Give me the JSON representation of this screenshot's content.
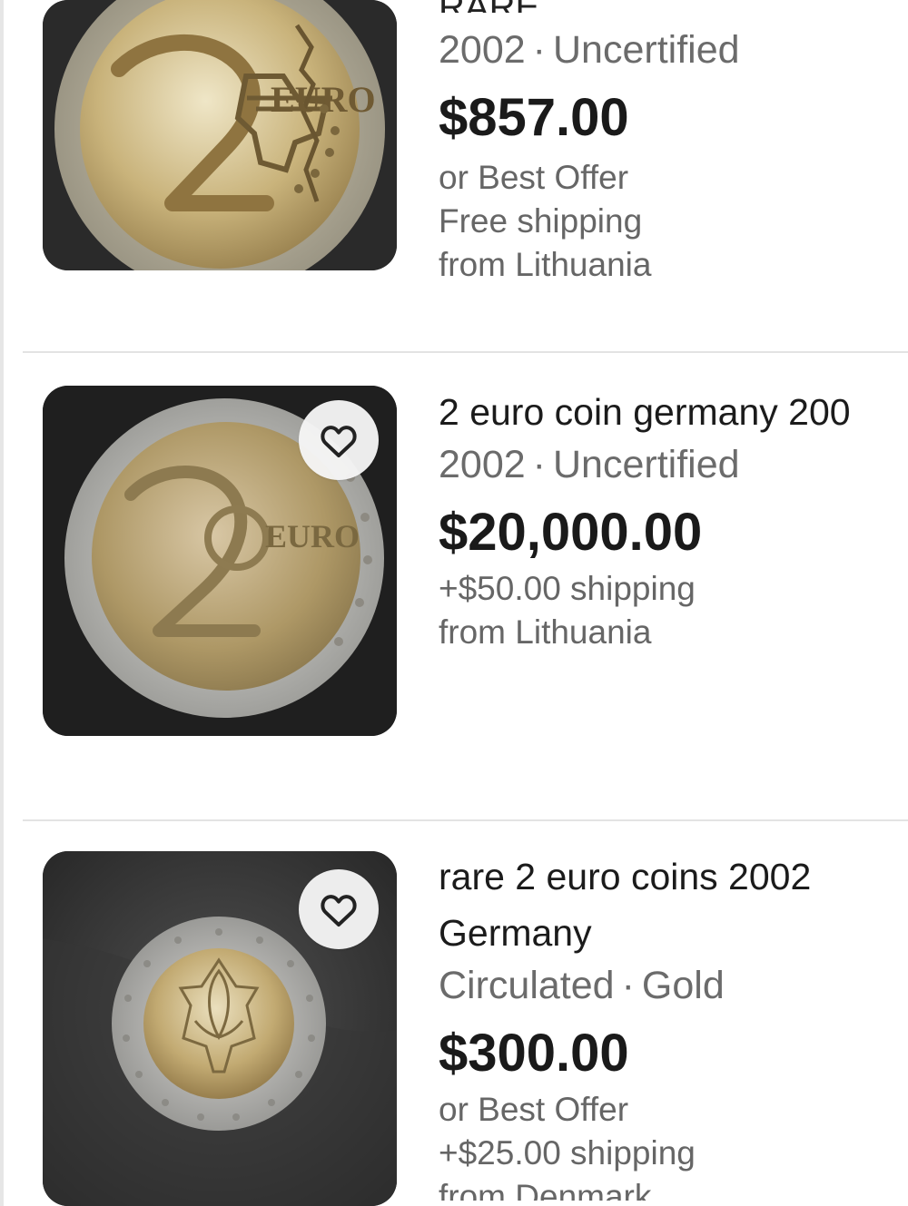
{
  "listings": [
    {
      "title_partial": "RARE",
      "meta": {
        "left": "2002",
        "sep": "·",
        "right": "Uncertified"
      },
      "price": "$857.00",
      "best_offer": "or Best Offer",
      "shipping": "Free shipping",
      "origin": "from Lithuania",
      "icons": {
        "coin": "coin-image",
        "heart": "heart-icon"
      }
    },
    {
      "title": "2 euro coin germany 200",
      "meta": {
        "left": "2002",
        "sep": "·",
        "right": "Uncertified"
      },
      "price": "$20,000.00",
      "shipping": "+$50.00 shipping",
      "origin": "from Lithuania",
      "icons": {
        "coin": "coin-image",
        "heart": "heart-icon"
      }
    },
    {
      "title_line1": "rare 2 euro coins 2002",
      "title_line2": "Germany",
      "meta": {
        "left": "Circulated",
        "sep": "·",
        "right": "Gold"
      },
      "price": "$300.00",
      "best_offer": "or Best Offer",
      "shipping": "+$25.00 shipping",
      "origin": "from Denmark",
      "icons": {
        "coin": "coin-image",
        "heart": "heart-icon"
      }
    }
  ],
  "colors": {
    "background": "#ffffff",
    "text_primary": "#1b1b1b",
    "text_secondary": "#6b6b6b",
    "divider": "#e3e3e3",
    "heart_bg": "#f5f5f5"
  }
}
